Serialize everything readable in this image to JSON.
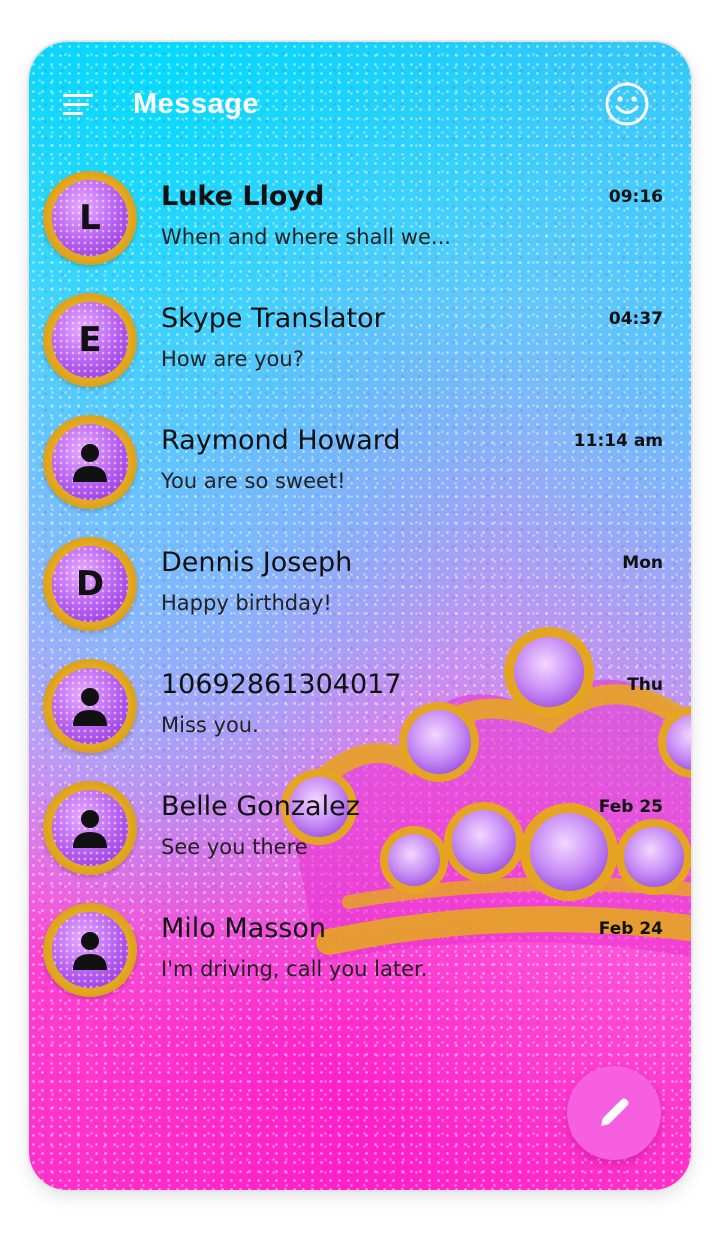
{
  "header": {
    "title": "Message",
    "menu_icon": "menu-icon",
    "emoji_icon": "smiley-icon"
  },
  "conversations": [
    {
      "avatar_letter": "L",
      "avatar_icon": null,
      "name": "Luke Lloyd",
      "preview": "When and where shall we...",
      "time": "09:16",
      "unread": true
    },
    {
      "avatar_letter": "E",
      "avatar_icon": null,
      "name": "Skype Translator",
      "preview": "How are you?",
      "time": "04:37",
      "unread": false
    },
    {
      "avatar_letter": "",
      "avatar_icon": "person-icon",
      "name": "Raymond Howard",
      "preview": "You are so sweet!",
      "time": "11:14 am",
      "unread": false
    },
    {
      "avatar_letter": "D",
      "avatar_icon": null,
      "name": "Dennis Joseph",
      "preview": "Happy birthday!",
      "time": "Mon",
      "unread": false
    },
    {
      "avatar_letter": "",
      "avatar_icon": "person-icon",
      "name": "10692861304017",
      "preview": "Miss you.",
      "time": "Thu",
      "unread": false
    },
    {
      "avatar_letter": "",
      "avatar_icon": "person-icon",
      "name": "Belle Gonzalez",
      "preview": "See you there",
      "time": "Feb 25",
      "unread": false
    },
    {
      "avatar_letter": "",
      "avatar_icon": "person-icon",
      "name": "Milo Masson",
      "preview": "I'm driving, call you later.",
      "time": "Feb 24",
      "unread": false
    }
  ],
  "fab": {
    "icon": "pencil-icon"
  },
  "colors": {
    "accent": "#f55fe0",
    "avatar_ring": "#e3a91e",
    "avatar_fill": "#b45cf0"
  }
}
